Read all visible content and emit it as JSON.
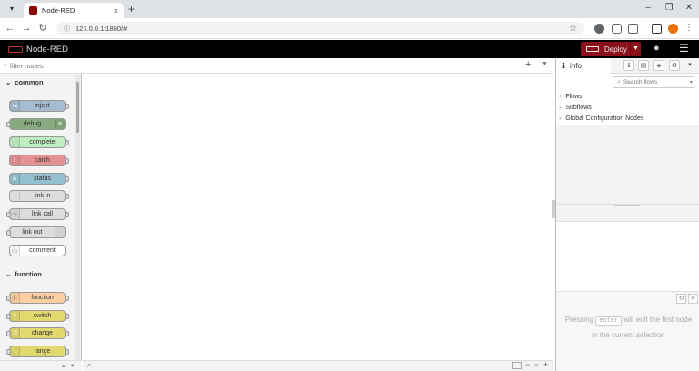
{
  "browser": {
    "tab_title": "Node-RED",
    "url": "127.0.0.1:1880/#",
    "new_tab": "+",
    "tab_close": "×"
  },
  "header": {
    "app_name": "Node-RED",
    "deploy_label": "Deploy"
  },
  "palette": {
    "filter_placeholder": "filter nodes",
    "categories": [
      {
        "name": "common",
        "nodes": [
          "inject",
          "debug",
          "complete",
          "catch",
          "status",
          "link in",
          "link call",
          "link out",
          "comment"
        ]
      },
      {
        "name": "function",
        "nodes": [
          "function",
          "switch",
          "change",
          "range"
        ]
      }
    ]
  },
  "sidebar": {
    "tab_label": "info",
    "search_placeholder": "Search flows",
    "tree": [
      "Flows",
      "Subflows",
      "Global Configuration Nodes"
    ],
    "tip_before": "Pressing",
    "tip_key": "enter",
    "tip_after": "will edit the first node in the current selection"
  },
  "colors": {
    "deploy": "#8c101c",
    "header_bg": "#000000",
    "inject": "#a6bbcf",
    "debug": "#87a980",
    "complete": "#c0edc0",
    "catch": "#e49191",
    "status": "#94c1d0",
    "link": "#dddddd",
    "comment": "#ffffff",
    "function": "#fdd0a2",
    "switch": "#e2d96e"
  }
}
